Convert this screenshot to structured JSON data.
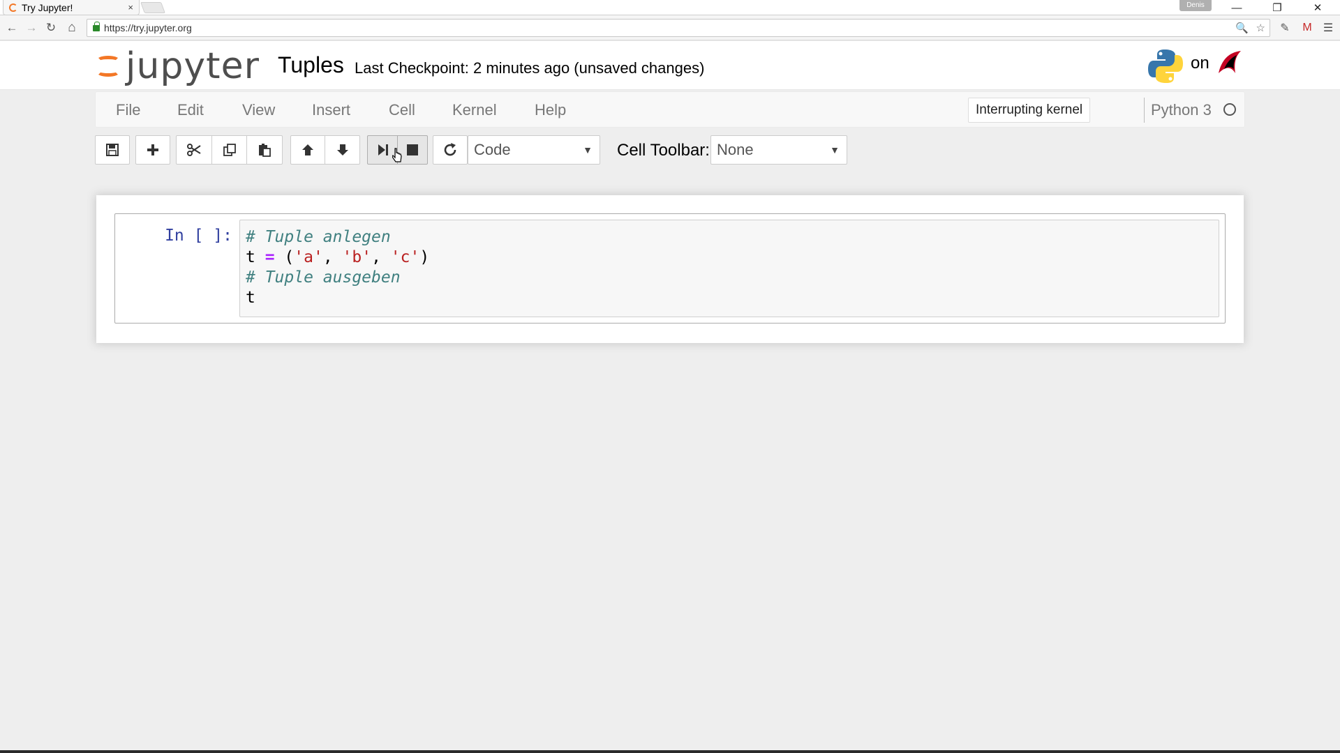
{
  "browser": {
    "tab_title": "Try Jupyter!",
    "tab_close": "×",
    "profile": "Denis",
    "url": "https://try.jupyter.org",
    "window_controls": {
      "minimize": "—",
      "restore": "❐",
      "close": "✕"
    },
    "nav": {
      "back": "←",
      "forward": "→",
      "reload": "↻",
      "home": "⌂"
    }
  },
  "header": {
    "logo_text": "jupyter",
    "notebook_name": "Tuples",
    "checkpoint": "Last Checkpoint: 2 minutes ago (unsaved changes)",
    "on_text": "on"
  },
  "menubar": {
    "items": [
      "File",
      "Edit",
      "View",
      "Insert",
      "Cell",
      "Kernel",
      "Help"
    ],
    "kernel_status": "Interrupting kernel",
    "kernel_name": "Python 3"
  },
  "toolbar": {
    "cell_type": "Code",
    "cell_toolbar_label": "Cell Toolbar:",
    "cell_toolbar_value": "None",
    "caret": "▼",
    "icons": [
      "save-icon",
      "plus-icon",
      "cut-icon",
      "copy-icon",
      "paste-icon",
      "arrow-up-icon",
      "arrow-down-icon",
      "run-icon",
      "stop-icon",
      "restart-icon"
    ]
  },
  "cell": {
    "prompt": "In [ ]:",
    "lines": [
      [
        {
          "t": "# Tuple anlegen",
          "c": "cm-comment"
        }
      ],
      [
        {
          "t": "t",
          "c": "cm-var"
        },
        {
          "t": " ",
          "c": "cm-punc"
        },
        {
          "t": "=",
          "c": "cm-op"
        },
        {
          "t": " (",
          "c": "cm-punc"
        },
        {
          "t": "'a'",
          "c": "cm-str"
        },
        {
          "t": ", ",
          "c": "cm-punc"
        },
        {
          "t": "'b'",
          "c": "cm-str"
        },
        {
          "t": ", ",
          "c": "cm-punc"
        },
        {
          "t": "'c'",
          "c": "cm-str"
        },
        {
          "t": ")",
          "c": "cm-punc"
        }
      ],
      [
        {
          "t": "# Tuple ausgeben",
          "c": "cm-comment"
        }
      ],
      [
        {
          "t": "t",
          "c": "cm-var"
        }
      ]
    ]
  },
  "colors": {
    "jupyter_orange": "#f37726",
    "prompt_blue": "#303f9f",
    "comment": "#408080",
    "string": "#ba2121",
    "operator": "#aa22ff"
  }
}
